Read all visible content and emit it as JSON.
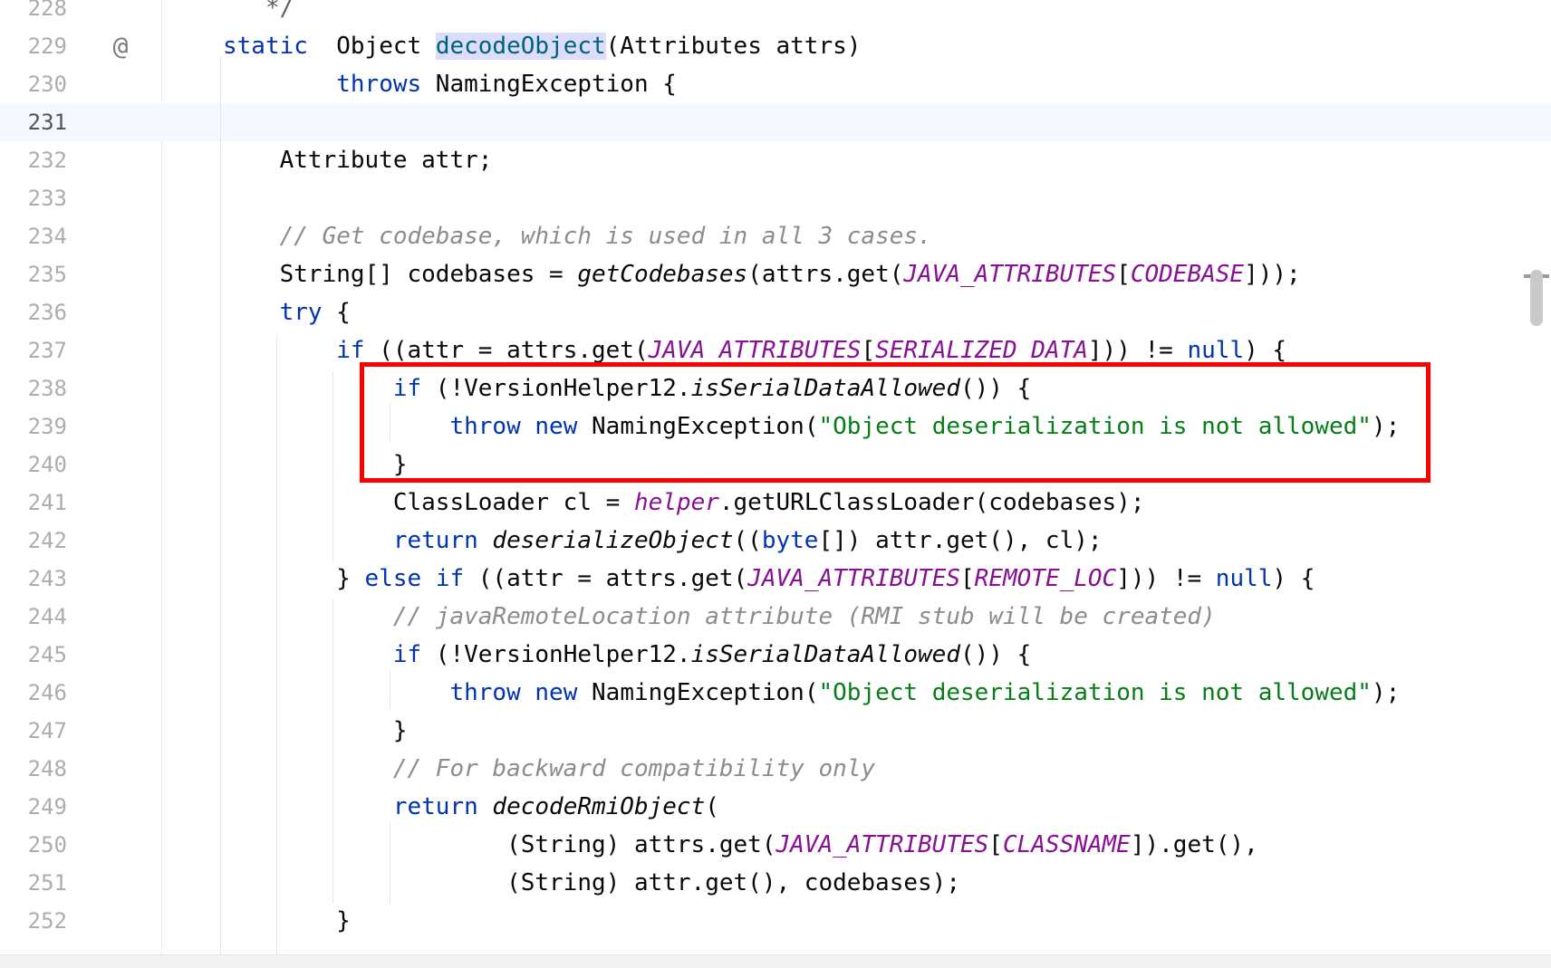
{
  "editor": {
    "lines": [
      {
        "number": "228",
        "mark": "",
        "current": false,
        "tokens": [
          [
            "f",
            "   */"
          ]
        ]
      },
      {
        "number": "229",
        "mark": "@",
        "current": false,
        "tokens": [
          [
            "k",
            "static"
          ],
          [
            "",
            "  Object "
          ],
          [
            "hl",
            "decodeObject"
          ],
          [
            "",
            "(Attributes attrs)"
          ]
        ]
      },
      {
        "number": "230",
        "mark": "",
        "current": false,
        "tokens": [
          [
            "",
            "        "
          ],
          [
            "k",
            "throws"
          ],
          [
            "",
            " NamingException {"
          ]
        ]
      },
      {
        "number": "231",
        "mark": "",
        "current": true,
        "tokens": []
      },
      {
        "number": "232",
        "mark": "",
        "current": false,
        "tokens": [
          [
            "",
            "    Attribute attr;"
          ]
        ]
      },
      {
        "number": "233",
        "mark": "",
        "current": false,
        "tokens": []
      },
      {
        "number": "234",
        "mark": "",
        "current": false,
        "tokens": [
          [
            "",
            "    "
          ],
          [
            "c",
            "// Get codebase, which is used in all 3 cases."
          ]
        ]
      },
      {
        "number": "235",
        "mark": "",
        "current": false,
        "tokens": [
          [
            "",
            "    String[] codebases = "
          ],
          [
            "i",
            "getCodebases"
          ],
          [
            "",
            "(attrs.get("
          ],
          [
            "fld",
            "JAVA_ATTRIBUTES"
          ],
          [
            "",
            "["
          ],
          [
            "fld",
            "CODEBASE"
          ],
          [
            "",
            "]));"
          ]
        ]
      },
      {
        "number": "236",
        "mark": "",
        "current": false,
        "tokens": [
          [
            "",
            "    "
          ],
          [
            "k",
            "try"
          ],
          [
            "",
            " {"
          ]
        ]
      },
      {
        "number": "237",
        "mark": "",
        "current": false,
        "tokens": [
          [
            "",
            "        "
          ],
          [
            "k",
            "if"
          ],
          [
            "",
            " ((attr = attrs.get("
          ],
          [
            "fld",
            "JAVA_ATTRIBUTES"
          ],
          [
            "",
            "["
          ],
          [
            "fld",
            "SERIALIZED_DATA"
          ],
          [
            "",
            "])) != "
          ],
          [
            "k",
            "null"
          ],
          [
            "",
            ") {"
          ]
        ]
      },
      {
        "number": "238",
        "mark": "",
        "current": false,
        "tokens": [
          [
            "",
            "            "
          ],
          [
            "k",
            "if"
          ],
          [
            "",
            " (!VersionHelper12."
          ],
          [
            "i",
            "isSerialDataAllowed"
          ],
          [
            "",
            "()) {"
          ]
        ]
      },
      {
        "number": "239",
        "mark": "",
        "current": false,
        "tokens": [
          [
            "",
            "                "
          ],
          [
            "k",
            "throw"
          ],
          [
            "",
            " "
          ],
          [
            "k",
            "new"
          ],
          [
            "",
            " NamingException("
          ],
          [
            "s",
            "\"Object deserialization is not allowed\""
          ],
          [
            "",
            ");"
          ]
        ]
      },
      {
        "number": "240",
        "mark": "",
        "current": false,
        "tokens": [
          [
            "",
            "            }"
          ]
        ]
      },
      {
        "number": "241",
        "mark": "",
        "current": false,
        "tokens": [
          [
            "",
            "            ClassLoader cl = "
          ],
          [
            "fld",
            "helper"
          ],
          [
            "",
            ".getURLClassLoader(codebases);"
          ]
        ]
      },
      {
        "number": "242",
        "mark": "",
        "current": false,
        "tokens": [
          [
            "",
            "            "
          ],
          [
            "k",
            "return"
          ],
          [
            "",
            " "
          ],
          [
            "i",
            "deserializeObject"
          ],
          [
            "",
            "(("
          ],
          [
            "k",
            "byte"
          ],
          [
            "",
            "[]) attr.get(), cl);"
          ]
        ]
      },
      {
        "number": "243",
        "mark": "",
        "current": false,
        "tokens": [
          [
            "",
            "        } "
          ],
          [
            "k",
            "else if"
          ],
          [
            "",
            " ((attr = attrs.get("
          ],
          [
            "fld",
            "JAVA_ATTRIBUTES"
          ],
          [
            "",
            "["
          ],
          [
            "fld",
            "REMOTE_LOC"
          ],
          [
            "",
            "])) != "
          ],
          [
            "k",
            "null"
          ],
          [
            "",
            ") {"
          ]
        ]
      },
      {
        "number": "244",
        "mark": "",
        "current": false,
        "tokens": [
          [
            "",
            "            "
          ],
          [
            "c",
            "// javaRemoteLocation attribute (RMI stub will be created)"
          ]
        ]
      },
      {
        "number": "245",
        "mark": "",
        "current": false,
        "tokens": [
          [
            "",
            "            "
          ],
          [
            "k",
            "if"
          ],
          [
            "",
            " (!VersionHelper12."
          ],
          [
            "i",
            "isSerialDataAllowed"
          ],
          [
            "",
            "()) {"
          ]
        ]
      },
      {
        "number": "246",
        "mark": "",
        "current": false,
        "tokens": [
          [
            "",
            "                "
          ],
          [
            "k",
            "throw"
          ],
          [
            "",
            " "
          ],
          [
            "k",
            "new"
          ],
          [
            "",
            " NamingException("
          ],
          [
            "s",
            "\"Object deserialization is not allowed\""
          ],
          [
            "",
            ");"
          ]
        ]
      },
      {
        "number": "247",
        "mark": "",
        "current": false,
        "tokens": [
          [
            "",
            "            }"
          ]
        ]
      },
      {
        "number": "248",
        "mark": "",
        "current": false,
        "tokens": [
          [
            "",
            "            "
          ],
          [
            "c",
            "// For backward compatibility only"
          ]
        ]
      },
      {
        "number": "249",
        "mark": "",
        "current": false,
        "tokens": [
          [
            "",
            "            "
          ],
          [
            "k",
            "return"
          ],
          [
            "",
            " "
          ],
          [
            "i",
            "decodeRmiObject"
          ],
          [
            "",
            "("
          ]
        ]
      },
      {
        "number": "250",
        "mark": "",
        "current": false,
        "tokens": [
          [
            "",
            "                    (String) attrs.get("
          ],
          [
            "fld",
            "JAVA_ATTRIBUTES"
          ],
          [
            "",
            "["
          ],
          [
            "fld",
            "CLASSNAME"
          ],
          [
            "",
            "]).get(),"
          ]
        ]
      },
      {
        "number": "251",
        "mark": "",
        "current": false,
        "tokens": [
          [
            "",
            "                    (String) attr.get(), codebases);"
          ]
        ]
      },
      {
        "number": "252",
        "mark": "",
        "current": false,
        "tokens": [
          [
            "",
            "        }"
          ]
        ]
      }
    ]
  },
  "colors": {
    "keyword": "#0033b3",
    "string": "#067d17",
    "comment": "#8c8c8c",
    "field": "#871094",
    "annotation_box": "#ff0000"
  }
}
